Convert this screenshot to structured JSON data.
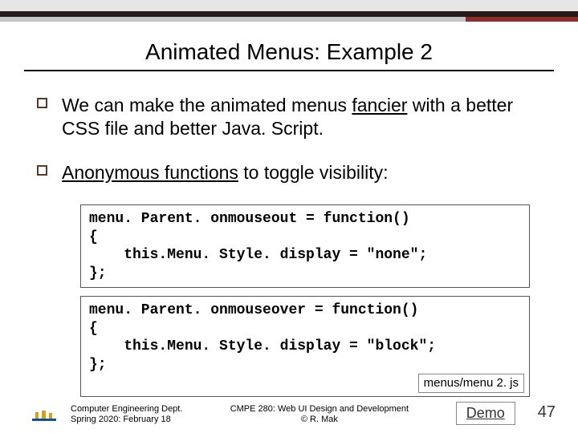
{
  "title": "Animated Menus: Example 2",
  "bullets": [
    {
      "pre": "We can make the animated menus ",
      "u": "fancier",
      "post": " with a better CSS file and better Java. Script."
    },
    {
      "pre": "",
      "u": "Anonymous functions",
      "post": " to toggle visibility:"
    }
  ],
  "code1": "menu. Parent. onmouseout = function()\n{\n    this.Menu. Style. display = \"none\";\n};",
  "code2": "menu. Parent. onmouseover = function()\n{\n    this.Menu. Style. display = \"block\";\n};",
  "file_label": "menus/menu 2. js",
  "footer": {
    "dept_line1": "Computer Engineering Dept.",
    "dept_line2": "Spring 2020: February 18",
    "course_line1": "CMPE 280: Web UI Design and Development",
    "course_line2": "© R. Mak"
  },
  "demo_label": "Demo",
  "page_number": "47"
}
